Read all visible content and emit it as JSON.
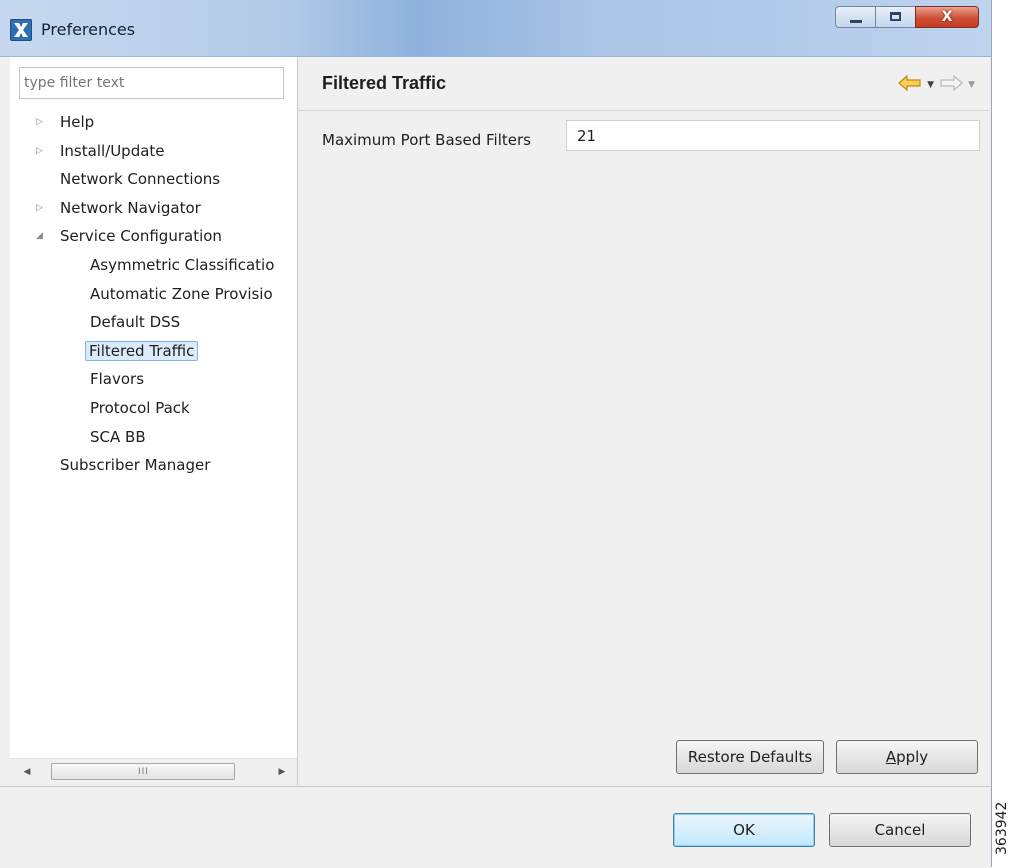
{
  "window": {
    "title": "Preferences",
    "icon": "preferences-app-icon",
    "controls": {
      "minimize": "minimize",
      "maximize": "maximize",
      "close": "X"
    }
  },
  "filter": {
    "value": "",
    "placeholder": "type filter text"
  },
  "tree": {
    "items": [
      {
        "label": "Help",
        "twisty": "collapsed",
        "level": 0
      },
      {
        "label": "Install/Update",
        "twisty": "collapsed",
        "level": 0
      },
      {
        "label": "Network Connections",
        "twisty": "none",
        "level": 0
      },
      {
        "label": "Network Navigator",
        "twisty": "collapsed",
        "level": 0
      },
      {
        "label": "Service Configuration",
        "twisty": "expanded",
        "level": 0
      },
      {
        "label": "Asymmetric Classificatio",
        "twisty": "none",
        "level": 1
      },
      {
        "label": "Automatic Zone Provisio",
        "twisty": "none",
        "level": 1
      },
      {
        "label": "Default DSS",
        "twisty": "none",
        "level": 1
      },
      {
        "label": "Filtered Traffic",
        "twisty": "none",
        "level": 1,
        "selected": true
      },
      {
        "label": "Flavors",
        "twisty": "none",
        "level": 1
      },
      {
        "label": "Protocol Pack",
        "twisty": "none",
        "level": 1
      },
      {
        "label": "SCA BB",
        "twisty": "none",
        "level": 1
      },
      {
        "label": "Subscriber Manager",
        "twisty": "none",
        "level": 0
      }
    ]
  },
  "scrollbar": {
    "grip": "III"
  },
  "page": {
    "title": "Filtered Traffic",
    "nav": {
      "back_icon": "back-arrow-icon",
      "forward_icon": "forward-arrow-icon"
    },
    "fields": {
      "max_port_filters_label": "Maximum Port Based Filters",
      "max_port_filters_value": "21"
    },
    "restore_defaults": "Restore Defaults",
    "apply_prefix": "",
    "apply_mnemonic": "A",
    "apply_rest": "pply"
  },
  "dialog": {
    "ok": "OK",
    "cancel": "Cancel"
  },
  "figure_id": "363942",
  "colors": {
    "selection_border": "#7eb4ea",
    "selection_fill": "#dcebfc",
    "back_arrow": "#f2b830"
  }
}
